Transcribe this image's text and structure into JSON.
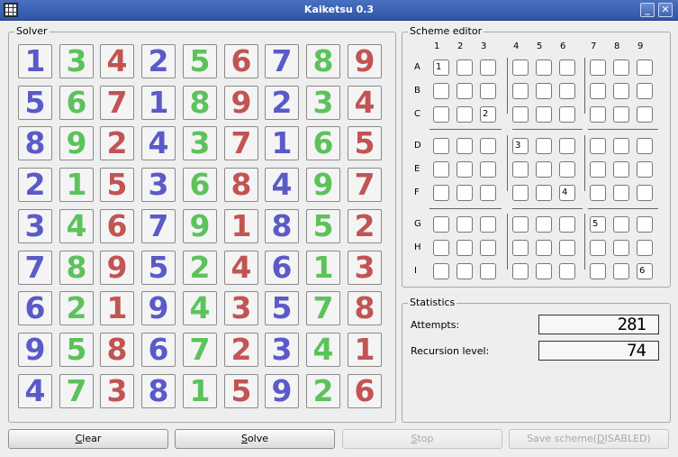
{
  "window": {
    "title": "Kaiketsu 0.3",
    "minimize_label": "_",
    "close_label": "✕"
  },
  "solver": {
    "title": "Solver",
    "grid": [
      [
        1,
        3,
        4,
        2,
        5,
        6,
        7,
        8,
        9
      ],
      [
        5,
        6,
        7,
        1,
        8,
        9,
        2,
        3,
        4
      ],
      [
        8,
        9,
        2,
        4,
        3,
        7,
        1,
        6,
        5
      ],
      [
        2,
        1,
        5,
        3,
        6,
        8,
        4,
        9,
        7
      ],
      [
        3,
        4,
        6,
        7,
        9,
        1,
        8,
        5,
        2
      ],
      [
        7,
        8,
        9,
        5,
        2,
        4,
        6,
        1,
        3
      ],
      [
        6,
        2,
        1,
        9,
        4,
        3,
        5,
        7,
        8
      ],
      [
        9,
        5,
        8,
        6,
        7,
        2,
        3,
        4,
        1
      ],
      [
        4,
        7,
        3,
        8,
        1,
        5,
        9,
        2,
        6
      ]
    ],
    "colors": [
      [
        "blue",
        "green",
        "red",
        "blue",
        "green",
        "red",
        "blue",
        "green",
        "red"
      ],
      [
        "blue",
        "green",
        "red",
        "blue",
        "green",
        "red",
        "blue",
        "green",
        "red"
      ],
      [
        "blue",
        "green",
        "red",
        "blue",
        "green",
        "red",
        "blue",
        "green",
        "red"
      ],
      [
        "blue",
        "green",
        "red",
        "blue",
        "green",
        "red",
        "blue",
        "green",
        "red"
      ],
      [
        "blue",
        "green",
        "red",
        "blue",
        "green",
        "red",
        "blue",
        "green",
        "red"
      ],
      [
        "blue",
        "green",
        "red",
        "blue",
        "green",
        "red",
        "blue",
        "green",
        "red"
      ],
      [
        "blue",
        "green",
        "red",
        "blue",
        "green",
        "red",
        "blue",
        "green",
        "red"
      ],
      [
        "blue",
        "green",
        "red",
        "blue",
        "green",
        "red",
        "blue",
        "green",
        "red"
      ],
      [
        "blue",
        "green",
        "red",
        "blue",
        "green",
        "red",
        "blue",
        "green",
        "red"
      ]
    ],
    "palette": {
      "blue": "#5a5ac8",
      "green": "#5cc25c",
      "red": "#c25454"
    }
  },
  "editor": {
    "title": "Scheme editor",
    "col_labels": [
      "1",
      "2",
      "3",
      "4",
      "5",
      "6",
      "7",
      "8",
      "9"
    ],
    "row_labels": [
      "A",
      "B",
      "C",
      "D",
      "E",
      "F",
      "G",
      "H",
      "I"
    ],
    "givens": [
      {
        "row": 0,
        "col": 0,
        "value": "1"
      },
      {
        "row": 2,
        "col": 2,
        "value": "2"
      },
      {
        "row": 3,
        "col": 3,
        "value": "3"
      },
      {
        "row": 5,
        "col": 5,
        "value": "4"
      },
      {
        "row": 6,
        "col": 6,
        "value": "5"
      },
      {
        "row": 8,
        "col": 8,
        "value": "6"
      }
    ]
  },
  "statistics": {
    "title": "Statistics",
    "attempts_label": "Attempts:",
    "attempts_value": "281",
    "recursion_label": "Recursion level:",
    "recursion_value": "74"
  },
  "buttons": {
    "clear": {
      "label_pre": "",
      "label_u": "C",
      "label_post": "lear"
    },
    "solve": {
      "label_pre": "",
      "label_u": "S",
      "label_post": "olve"
    },
    "stop": {
      "label_pre": "",
      "label_u": "S",
      "label_post": "top"
    },
    "save": {
      "label_pre": "Save scheme(",
      "label_u": "D",
      "label_post": "ISABLED)"
    }
  }
}
